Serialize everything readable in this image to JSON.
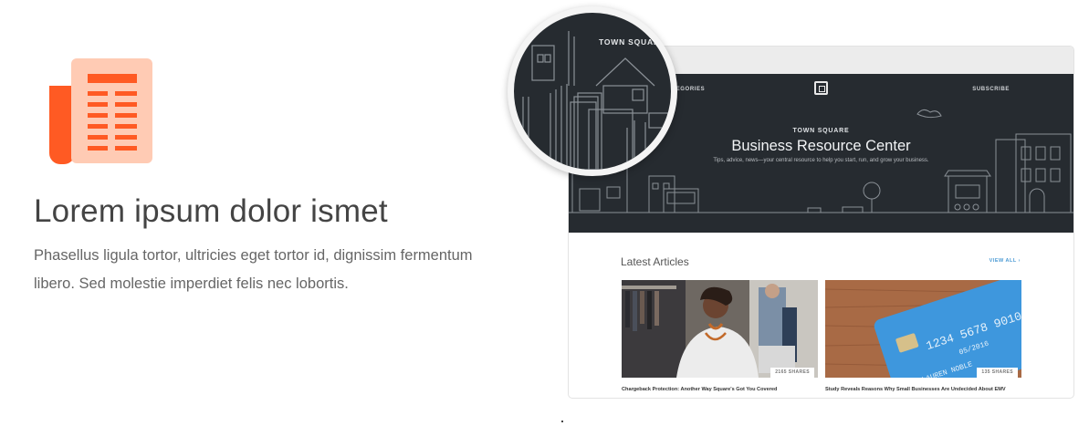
{
  "feature": {
    "icon": "newspaper-icon",
    "title": "Lorem ipsum dolor ismet",
    "description": "Phasellus ligula tortor, ultricies eget tortor id, dignissim fermentum libero. Sed molestie imperdiet felis nec lobortis."
  },
  "colors": {
    "icon_dark": "#ff5a23",
    "icon_light": "#ffcbb4",
    "hero_bg": "#262b30",
    "link": "#4a9ad4"
  },
  "preview": {
    "nav_left": "CATEGORIES",
    "nav_right": "SUBSCRIBE",
    "logo_icon": "square-logo-icon",
    "eyebrow": "TOWN SQUARE",
    "title": "Business Resource Center",
    "subtitle": "Tips, advice, news—your central resource to help you start, run, and grow your business.",
    "section_title": "Latest Articles",
    "view_all": "VIEW ALL ›",
    "articles": [
      {
        "shares": "2165 SHARES",
        "title": "Chargeback Protection: Another Way Square's Got You Covered"
      },
      {
        "shares": "135 SHARES",
        "title": "Study Reveals Reasons Why Small Businesses Are Undecided About EMV"
      }
    ],
    "card_text": {
      "number": "1234 5678 9010",
      "expiry": "05/2016",
      "name": "LAUREN NOBLE"
    }
  },
  "magnifier": {
    "label": "TOWN SQUARE"
  }
}
